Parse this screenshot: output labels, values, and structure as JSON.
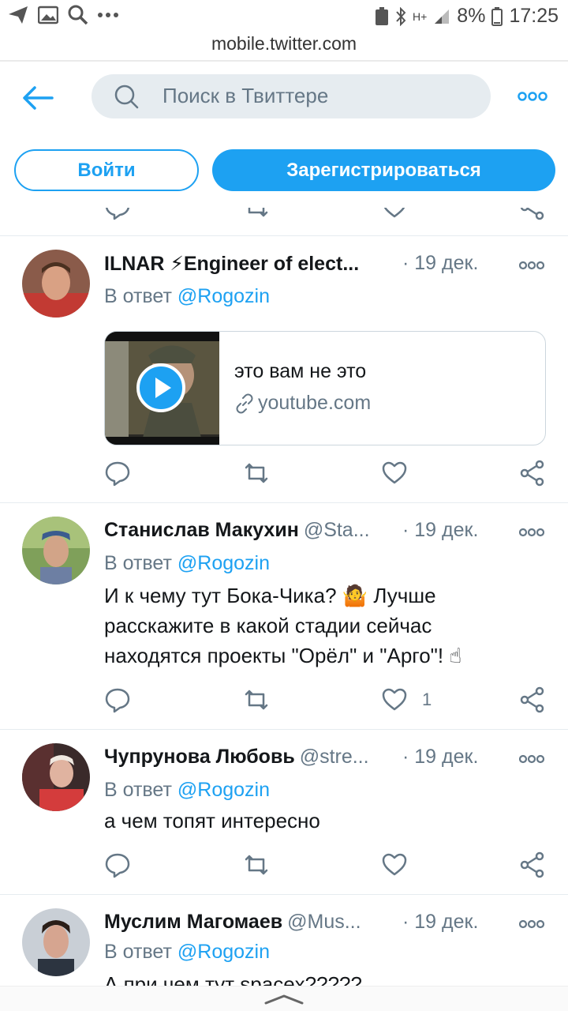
{
  "status_bar": {
    "battery": "8%",
    "time": "17:25",
    "network": "H+"
  },
  "browser": {
    "url": "mobile.twitter.com"
  },
  "header": {
    "search_placeholder": "Поиск в Твиттере",
    "login_label": "Войти",
    "signup_label": "Зарегистрироваться"
  },
  "colors": {
    "accent": "#1da1f2",
    "muted": "#657786",
    "border": "#e6ecf0"
  },
  "tweets": [
    {
      "name": "ILNAR ⚡Engineer of elect...",
      "handle": "",
      "date": "· 19 дек.",
      "reply_prefix": "В ответ",
      "reply_to": "@Rogozin",
      "card": {
        "title": "это вам не это",
        "domain": "youtube.com"
      },
      "likes": ""
    },
    {
      "name": "Станислав Макухин",
      "handle": "@Sta...",
      "date": "· 19 дек.",
      "reply_prefix": "В ответ",
      "reply_to": "@Rogozin",
      "text_line1": "И к чему тут Бока-Чика? 🤷 Лучше",
      "text_line2": "расскажите в какой стадии сейчас",
      "text_line3": "находятся проекты \"Орёл\" и \"Арго\"! ☝",
      "likes": "1"
    },
    {
      "name": "Чупрунова Любовь",
      "handle": "@stre...",
      "date": "· 19 дек.",
      "reply_prefix": "В ответ",
      "reply_to": "@Rogozin",
      "text": "а чем топят интересно",
      "likes": ""
    },
    {
      "name": "Муслим Магомаев",
      "handle": "@Mus...",
      "date": "· 19 дек.",
      "reply_prefix": "В ответ",
      "reply_to": "@Rogozin",
      "text": "А при чем тут spacex?????"
    }
  ],
  "icons": [
    "back-arrow-icon",
    "search-icon",
    "more-icon",
    "reply-icon",
    "retweet-icon",
    "like-icon",
    "share-icon",
    "link-icon",
    "play-icon",
    "chevron-up-icon"
  ]
}
